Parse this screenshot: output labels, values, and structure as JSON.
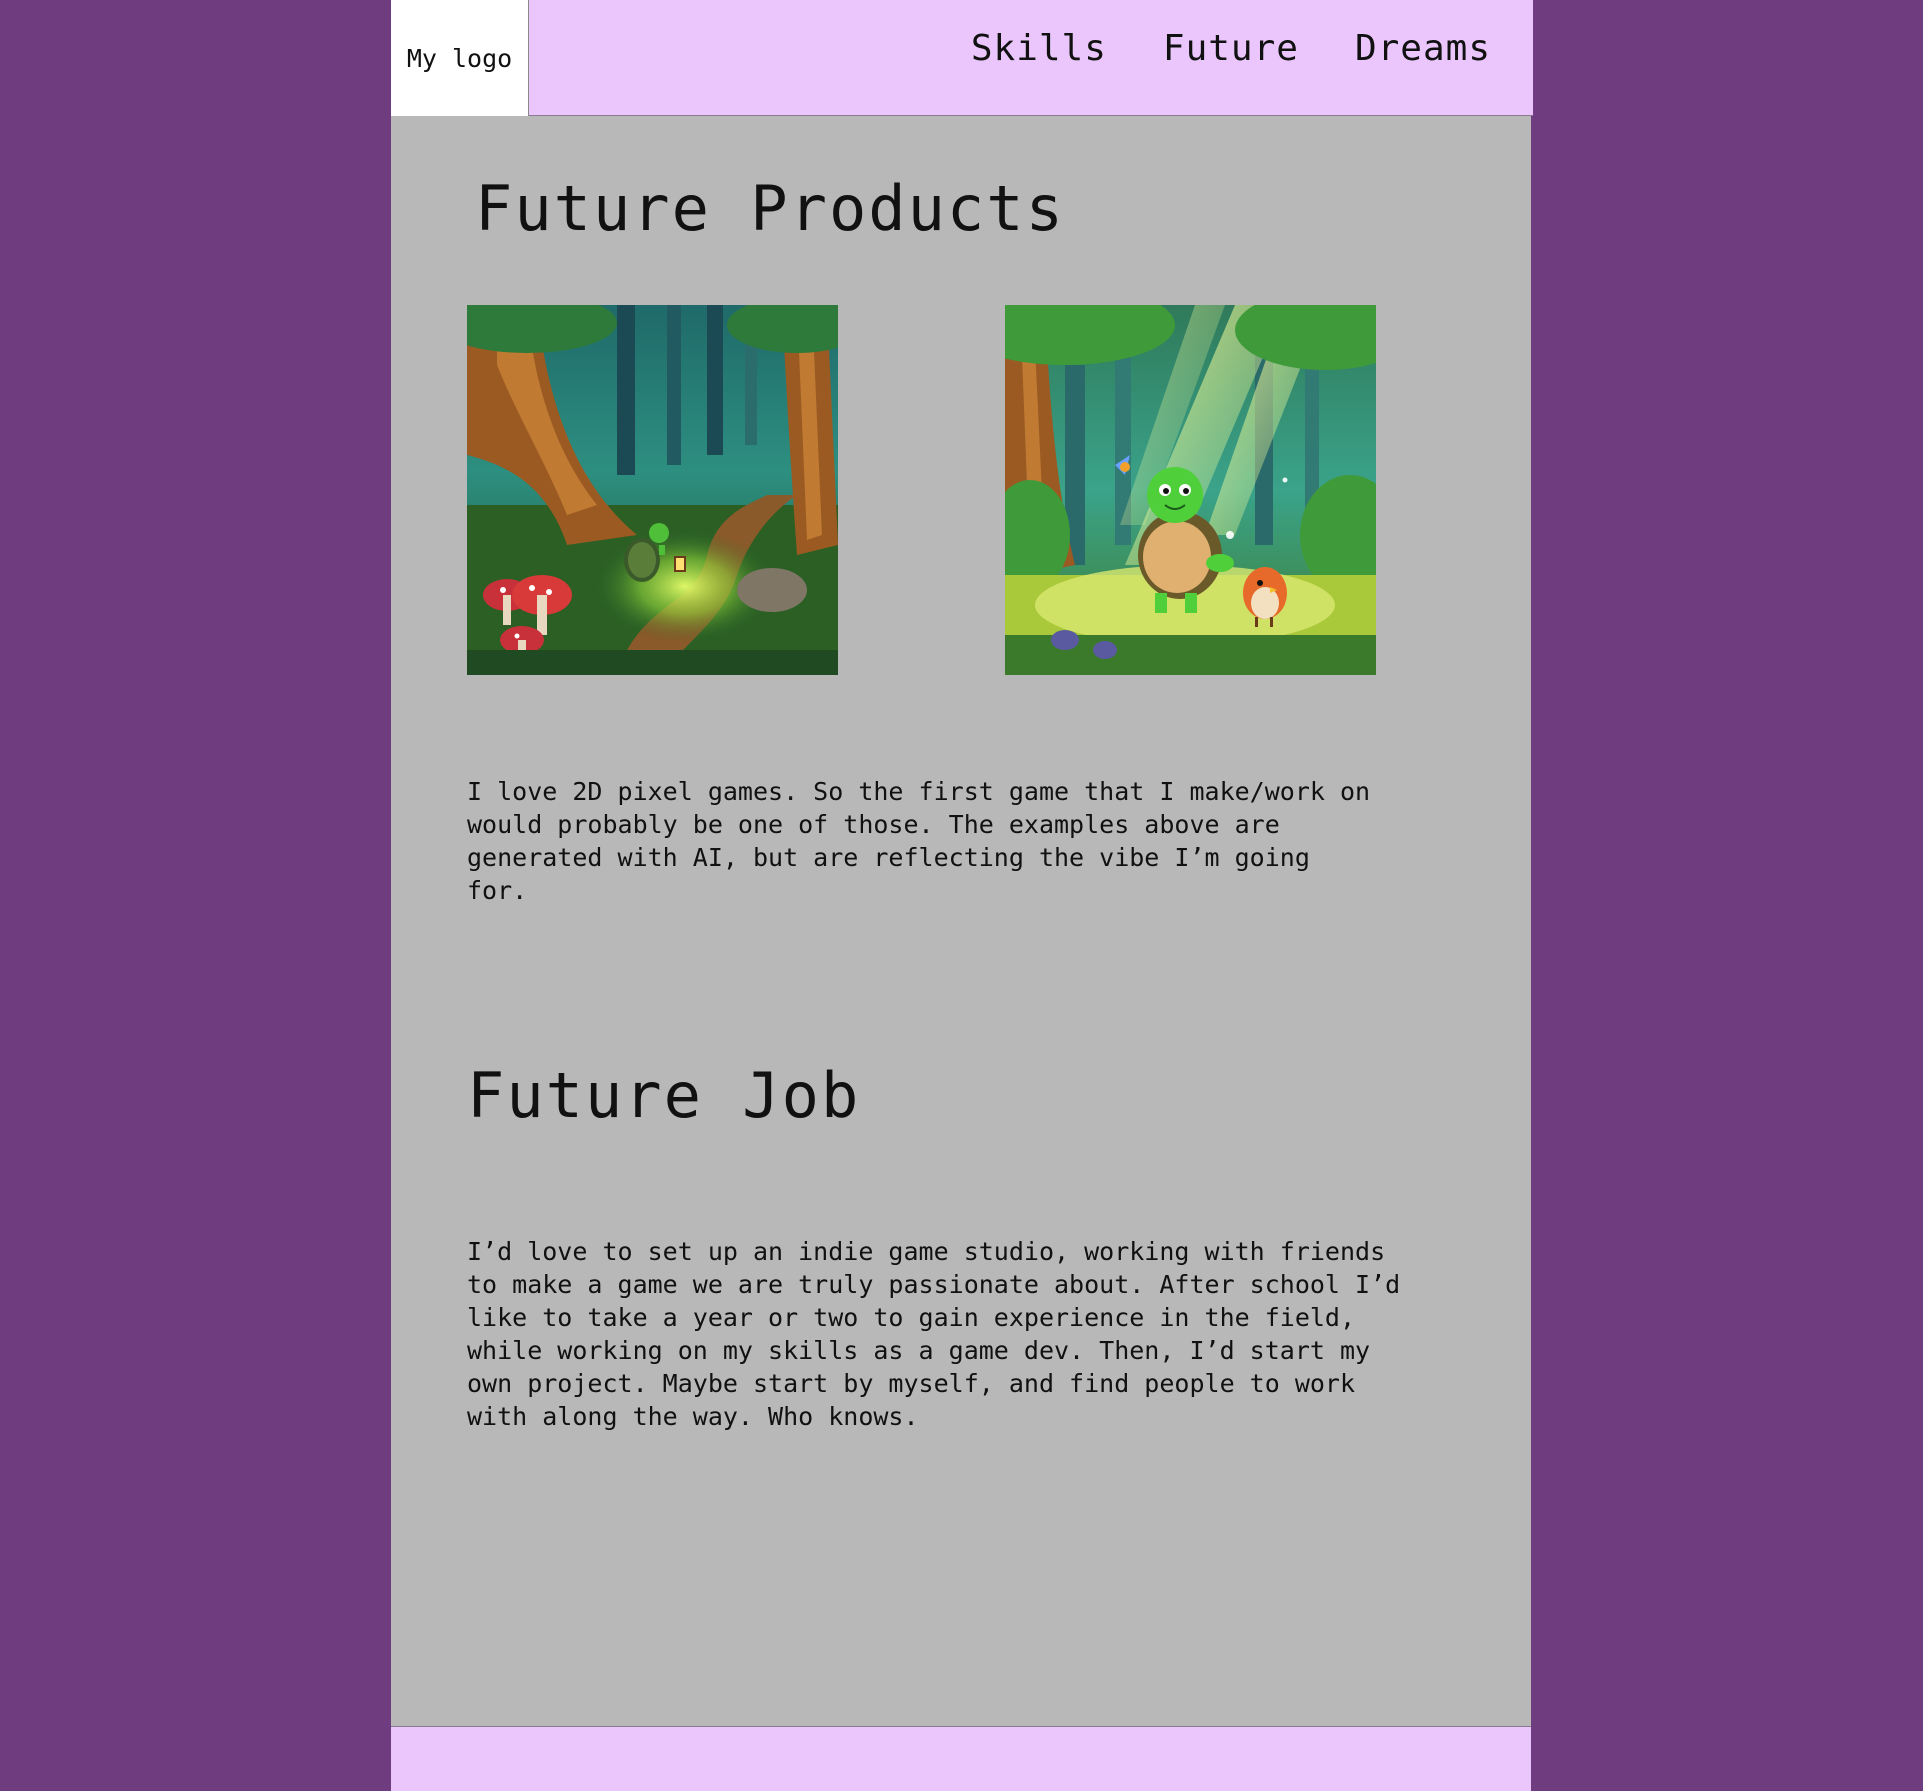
{
  "header": {
    "logo_text": "My logo",
    "nav": [
      {
        "label": "Skills"
      },
      {
        "label": "Future"
      },
      {
        "label": "Dreams"
      }
    ]
  },
  "future_products": {
    "title": "Future Products",
    "images": [
      {
        "subject": "pixel-art turtle with lantern on forest path"
      },
      {
        "subject": "pixel-art turtle and bird in sunlit forest clearing"
      }
    ],
    "text": "I love 2D pixel games. So the first game that I make/work on\nwould probably be one of those. The examples above are\ngenerated with AI, but are reflecting the vibe I’m going\nfor."
  },
  "future_job": {
    "title": "Future Job",
    "text": "I’d love to set up an indie game studio, working with friends\nto make a game we are truly passionate about. After school I’d\nlike to take a year or two to gain experience in the field,\nwhile working on my skills as a game dev. Then, I’d start my\nown project. Maybe start by myself, and find people to work\nwith along the way. Who knows."
  },
  "colors": {
    "background": "#6f3c7f",
    "header_footer": "#ebc6fc",
    "content": "#b8b8b8",
    "logo_box": "#ffffff"
  }
}
